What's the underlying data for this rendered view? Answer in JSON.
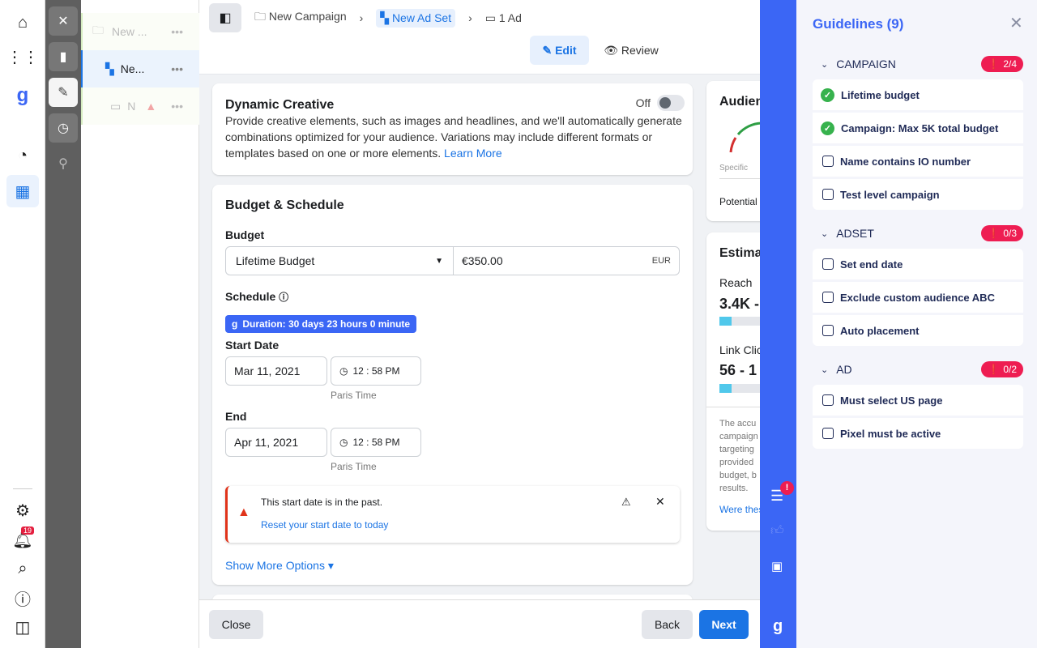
{
  "nav": {
    "notifications": "19"
  },
  "tree": {
    "campaign": "New ...",
    "adset": "Ne...",
    "ad": "N"
  },
  "header": {
    "breadcrumbs": [
      "New Campaign",
      "New Ad Set",
      "1 Ad"
    ],
    "tabs": [
      "Edit",
      "Review"
    ]
  },
  "dynamic_creative": {
    "title": "Dynamic Creative",
    "toggle": "Off",
    "description": "Provide creative elements, such as images and headlines, and we'll automatically generate combinations optimized for your audience. Variations may include different formats or templates based on one or more elements.",
    "link": "Learn More"
  },
  "budget": {
    "title": "Budget & Schedule",
    "budget_label": "Budget",
    "budget_type": "Lifetime Budget",
    "amount": "€350.00",
    "currency": "EUR",
    "schedule_label": "Schedule",
    "duration": "Duration: 30 days 23 hours 0 minute",
    "start_label": "Start Date",
    "start_date": "Mar 11, 2021",
    "start_time": "12 : 58 PM",
    "timezone": "Paris Time",
    "end_label": "End",
    "end_date": "Apr 11, 2021",
    "end_time": "12 : 58 PM",
    "warning": "This start date is in the past.",
    "warning_link": "Reset your start date to today",
    "more": "Show More Options"
  },
  "audience": {
    "title": "Audien",
    "specific": "Specific",
    "potential": "Potential"
  },
  "estimate": {
    "title": "Estima",
    "reach": "Reach",
    "reach_val": "3.4K -",
    "clicks": "Link Clic",
    "clicks_val": "56 - 1",
    "note": [
      "The accu",
      "campaign",
      "targeting",
      "provided",
      "budget, b",
      "results."
    ],
    "link": "Were thes"
  },
  "footer": {
    "close": "Close",
    "back": "Back",
    "next": "Next"
  },
  "guidelines": {
    "title": "Guidelines (9)",
    "sections": [
      {
        "name": "CAMPAIGN",
        "badge": "2/4",
        "items": [
          {
            "label": "Lifetime budget",
            "done": true
          },
          {
            "label": "Campaign: Max 5K total budget",
            "done": true
          },
          {
            "label": "Name contains IO number",
            "done": false
          },
          {
            "label": "Test level campaign",
            "done": false
          }
        ]
      },
      {
        "name": "ADSET",
        "badge": "0/3",
        "items": [
          {
            "label": "Set end date",
            "done": false
          },
          {
            "label": "Exclude custom audience ABC",
            "done": false
          },
          {
            "label": "Auto placement",
            "done": false
          }
        ]
      },
      {
        "name": "AD",
        "badge": "0/2",
        "items": [
          {
            "label": "Must select US page",
            "done": false
          },
          {
            "label": "Pixel must be active",
            "done": false
          }
        ]
      }
    ]
  },
  "colors": {
    "accent": "#1b74e4",
    "brand": "#3b66f5",
    "error": "#ee1d52"
  }
}
